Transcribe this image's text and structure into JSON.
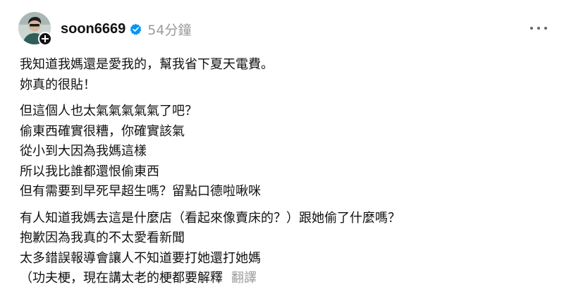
{
  "post": {
    "username": "soon6669",
    "timestamp": "54分鐘",
    "paragraphs": [
      {
        "lines": [
          "我知道我媽還是愛我的，幫我省下夏天電費。",
          "妳真的很貼！"
        ]
      },
      {
        "lines": [
          "但這個人也太氣氣氣氣氣了吧？",
          "偷東西確實很糟，你確實該氣",
          "從小到大因為我媽這樣",
          "所以我比誰都還恨偷東西",
          "但有需要到早死早超生嗎？留點口德啦啾咪"
        ]
      },
      {
        "lines": [
          "有人知道我媽去這是什麼店（看起來像賣床的？）跟她偷了什麼嗎？",
          "抱歉因為我真的不太愛看新聞",
          "太多錯誤報導會讓人不知道要打她還打她媽",
          "（功夫梗，現在講太老的梗都要解釋"
        ]
      }
    ],
    "translate_label": "翻譯"
  },
  "colors": {
    "text": "#111111",
    "muted": "#9a9a9a",
    "verified_badge": "#0095f6"
  },
  "icons": {
    "verified": "verified-badge-icon",
    "follow": "plus-icon",
    "more": "more-dots-icon"
  }
}
